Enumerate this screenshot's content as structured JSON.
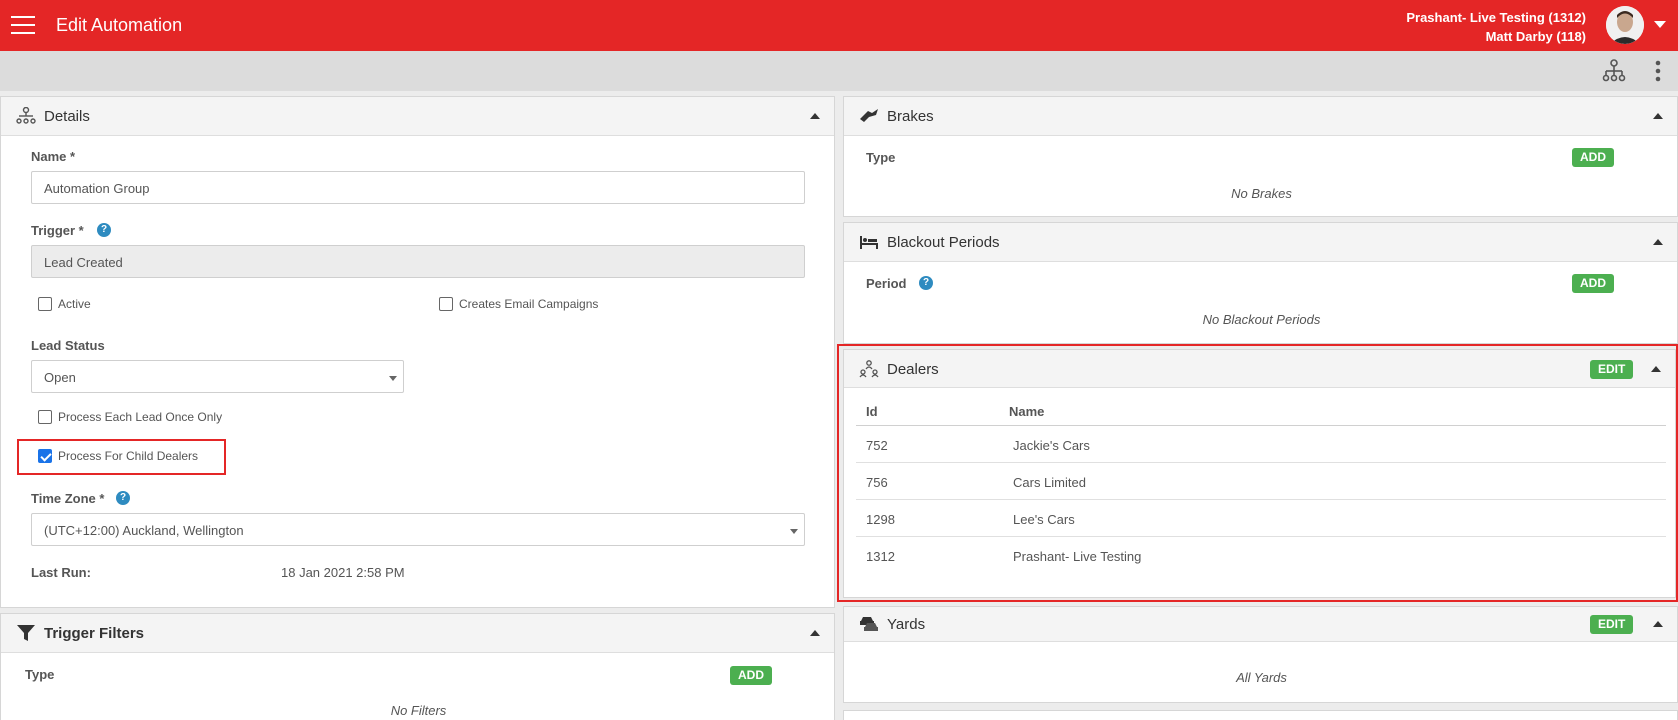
{
  "header": {
    "title": "Edit Automation",
    "user_line1": "Prashant- Live Testing (1312)",
    "user_line2": "Matt Darby (118)"
  },
  "details": {
    "title": "Details",
    "name_label": "Name *",
    "name_value": "Automation Group",
    "trigger_label": "Trigger *",
    "trigger_value": "Lead Created",
    "active_label": "Active",
    "active_checked": false,
    "creates_email_label": "Creates Email Campaigns",
    "creates_email_checked": false,
    "lead_status_label": "Lead Status",
    "lead_status_value": "Open",
    "process_once_label": "Process Each Lead Once Only",
    "process_once_checked": false,
    "process_child_label": "Process For Child Dealers",
    "process_child_checked": true,
    "timezone_label": "Time Zone *",
    "timezone_value": "(UTC+12:00) Auckland, Wellington",
    "last_run_label": "Last Run:",
    "last_run_value": "18 Jan 2021 2:58 PM"
  },
  "trigger_filters": {
    "title": "Trigger Filters",
    "type_label": "Type",
    "add_label": "ADD",
    "empty": "No Filters"
  },
  "brakes": {
    "title": "Brakes",
    "type_label": "Type",
    "add_label": "ADD",
    "empty": "No Brakes"
  },
  "blackout": {
    "title": "Blackout Periods",
    "period_label": "Period",
    "add_label": "ADD",
    "empty": "No Blackout Periods"
  },
  "dealers": {
    "title": "Dealers",
    "edit_label": "EDIT",
    "col_id": "Id",
    "col_name": "Name",
    "rows": [
      {
        "id": "752",
        "name": "Jackie's Cars"
      },
      {
        "id": "756",
        "name": "Cars Limited"
      },
      {
        "id": "1298",
        "name": "Lee's Cars"
      },
      {
        "id": "1312",
        "name": "Prashant- Live Testing"
      }
    ]
  },
  "yards": {
    "title": "Yards",
    "edit_label": "EDIT",
    "empty": "All Yards"
  },
  "help_glyph": "?",
  "colors": {
    "brand_red": "#e42626",
    "accent_green": "#4caf50",
    "help_blue": "#2e8bc0"
  }
}
